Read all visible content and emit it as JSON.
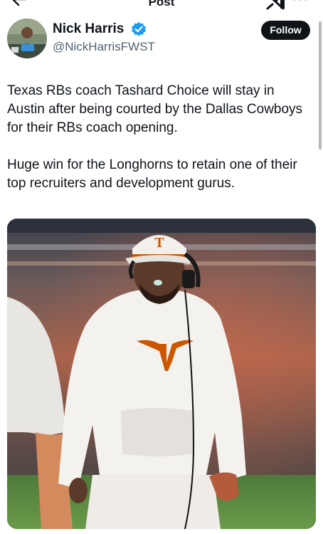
{
  "header": {
    "title": "Post",
    "back_icon": "arrow-left-icon",
    "grok_icon": "grok-icon",
    "more_icon": "more-options-icon"
  },
  "author": {
    "name": "Nick Harris",
    "handle": "@NickHarrisFWST",
    "verified": true,
    "follow_label": "Follow"
  },
  "tweet": {
    "paragraphs": [
      "Texas RBs coach Tashard Choice will stay in Austin after being courted by the Dallas Cowboys for their RBs coach opening.",
      "Huge win for the Longhorns to retain one of their top recruiters and development gurus."
    ]
  },
  "media": {
    "hat_logo": "T",
    "colors": {
      "burnt_orange": "#cc5500",
      "verified_blue": "#1d9bf0",
      "follow_bg": "#0f1419"
    }
  }
}
